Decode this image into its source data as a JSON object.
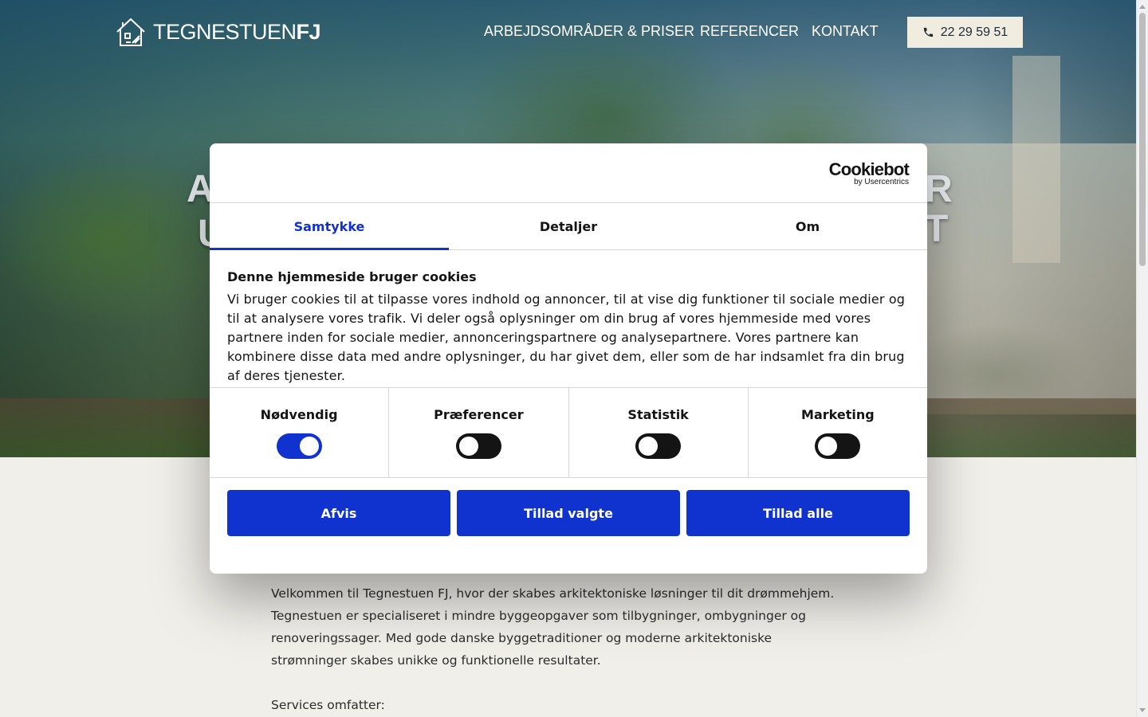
{
  "header": {
    "logo_text_light": "TEGNESTUEN",
    "logo_text_bold": "FJ",
    "nav": [
      {
        "label": "ARBEJDSOMRÅDER & PRISER"
      },
      {
        "label": "REFERENCER"
      },
      {
        "label": "KONTAKT"
      }
    ],
    "phone": "22 29 59 51"
  },
  "hero": {
    "title_line1_start": "A",
    "title_line1_end": "R",
    "title_line2_start": "U",
    "title_line2_end": "T"
  },
  "content": {
    "intro": "Velkommen til Tegnestuen FJ, hvor der skabes arkitektoniske løsninger til dit drømmehjem. Tegnestuen er specialiseret i mindre byggeopgaver som tilbygninger, ombygninger og renoveringssager. Med gode danske byggetraditioner og moderne arkitektoniske strømninger skabes unikke og funktionelle resultater.",
    "services_label": "Services omfatter:"
  },
  "cookie_dialog": {
    "brand": "Cookiebot",
    "brand_sub": "by Usercentrics",
    "tabs": [
      {
        "label": "Samtykke",
        "active": true
      },
      {
        "label": "Detaljer",
        "active": false
      },
      {
        "label": "Om",
        "active": false
      }
    ],
    "heading": "Denne hjemmeside bruger cookies",
    "text": "Vi bruger cookies til at tilpasse vores indhold og annoncer, til at vise dig funktioner til sociale medier og til at analysere vores trafik. Vi deler også oplysninger om din brug af vores hjemmeside med vores partnere inden for sociale medier, annonceringspartnere og analysepartnere. Vores partnere kan kombinere disse data med andre oplysninger, du har givet dem, eller som de har indsamlet fra din brug af deres tjenester.",
    "toggles": [
      {
        "label": "Nødvendig",
        "on": true
      },
      {
        "label": "Præferencer",
        "on": false
      },
      {
        "label": "Statistik",
        "on": false
      },
      {
        "label": "Marketing",
        "on": false
      }
    ],
    "buttons": {
      "decline": "Afvis",
      "allow_selected": "Tillad valgte",
      "allow_all": "Tillad alle"
    }
  },
  "colors": {
    "accent_blue": "#1032cf",
    "page_bg": "#f1efea",
    "phone_button_bg": "#f1ece0"
  }
}
